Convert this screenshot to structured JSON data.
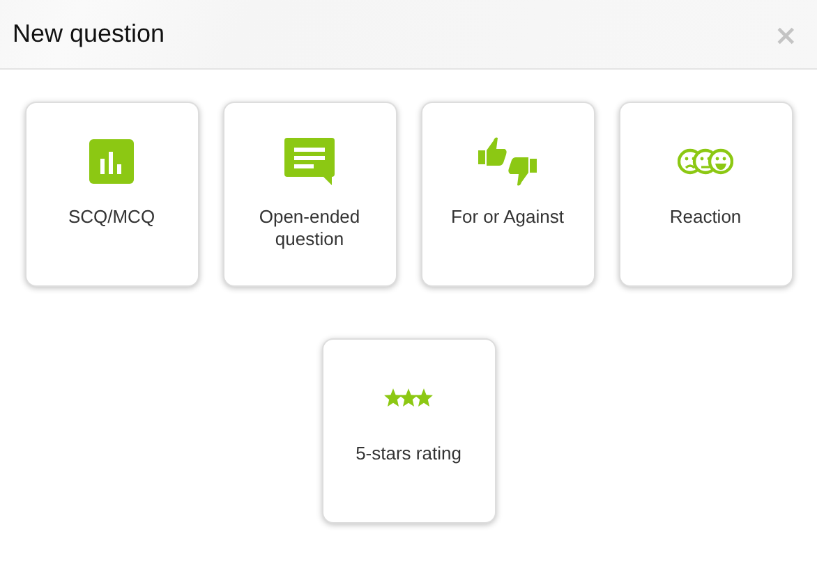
{
  "dialog": {
    "title": "New question",
    "close": "×"
  },
  "question_types": [
    {
      "kind": "chart",
      "label": "SCQ/MCQ"
    },
    {
      "kind": "speech",
      "label": "Open-ended question"
    },
    {
      "kind": "thumbs",
      "label": "For or Against"
    },
    {
      "kind": "faces",
      "label": "Reaction"
    },
    {
      "kind": "stars",
      "label": "5-stars rating"
    }
  ]
}
